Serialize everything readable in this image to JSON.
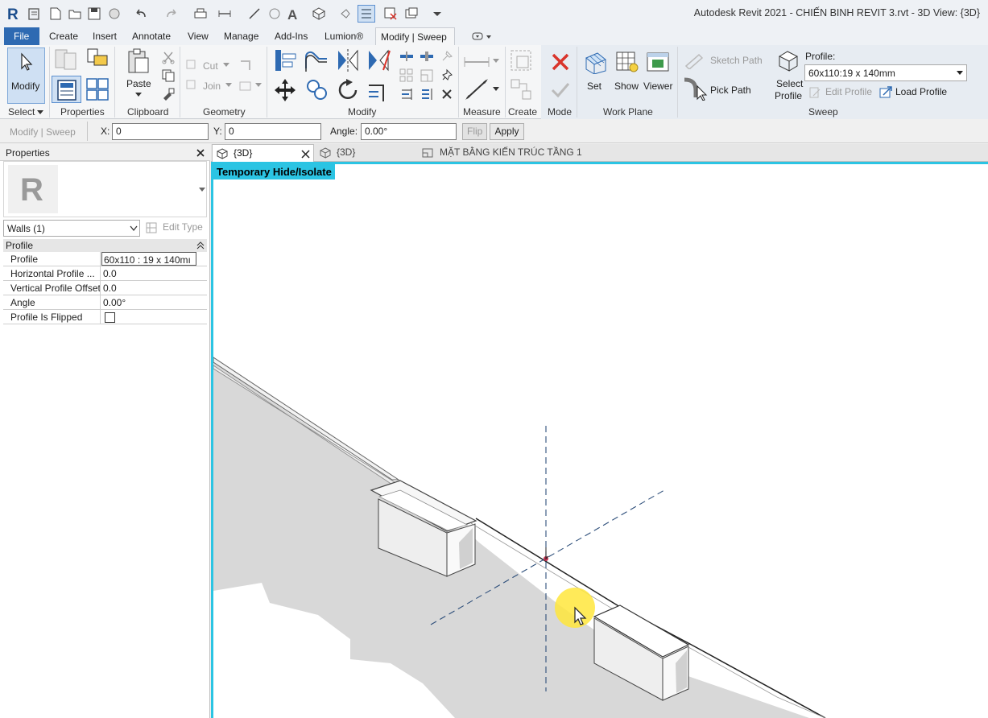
{
  "app_title": "Autodesk Revit 2021 - CHIẾN BINH REVIT 3.rvt - 3D View: {3D}",
  "ribbon_tabs": [
    "File",
    "Create",
    "Insert",
    "Annotate",
    "View",
    "Manage",
    "Add-Ins",
    "Lumion®",
    "Modify | Sweep"
  ],
  "panels": {
    "select": {
      "label": "Select",
      "modify_label": "Modify"
    },
    "properties": {
      "label": "Properties"
    },
    "clipboard": {
      "label": "Clipboard",
      "paste_label": "Paste"
    },
    "geometry": {
      "label": "Geometry",
      "cut_label": "Cut",
      "join_label": "Join"
    },
    "modify": {
      "label": "Modify"
    },
    "measure": {
      "label": "Measure"
    },
    "create": {
      "label": "Create"
    },
    "mode": {
      "label": "Mode"
    },
    "work_plane": {
      "label": "Work Plane",
      "set_label": "Set",
      "show_label": "Show",
      "viewer_label": "Viewer"
    },
    "sweep": {
      "label": "Sweep",
      "sketch_path_label": "Sketch Path",
      "pick_path_label": "Pick Path",
      "select_profile_label": "Select",
      "select_profile_label2": "Profile",
      "profile_caption": "Profile:",
      "profile_value": "60x110:19 x 140mm",
      "edit_profile_label": "Edit Profile",
      "load_profile_label": "Load Profile"
    }
  },
  "options_bar": {
    "context": "Modify | Sweep",
    "x_label": "X:",
    "x_value": "0",
    "y_label": "Y:",
    "y_value": "0",
    "angle_label": "Angle:",
    "angle_value": "0.00°",
    "flip_label": "Flip",
    "apply_label": "Apply"
  },
  "properties_palette": {
    "title": "Properties",
    "type_selector": "Walls (1)",
    "edit_type_label": "Edit Type",
    "group_header": "Profile",
    "rows": [
      {
        "name": "Profile",
        "value": "60x110 : 19 x 140mı"
      },
      {
        "name": "Horizontal Profile ...",
        "value": "0.0"
      },
      {
        "name": "Vertical Profile Offset",
        "value": "0.0"
      },
      {
        "name": "Angle",
        "value": "0.00°"
      },
      {
        "name": "Profile Is Flipped",
        "value": ""
      }
    ]
  },
  "view_tabs": [
    {
      "label": "{3D}",
      "active": true
    },
    {
      "label": "{3D}",
      "active": false
    },
    {
      "label": "MẶT BẰNG KIẾN TRÚC TẦNG 1",
      "active": false
    }
  ],
  "canvas": {
    "temporary_label": "Temporary Hide/Isolate"
  },
  "colors": {
    "accent": "#2bc4e3",
    "file_tab": "#2e6ab2",
    "cancel_red": "#d9342b"
  }
}
